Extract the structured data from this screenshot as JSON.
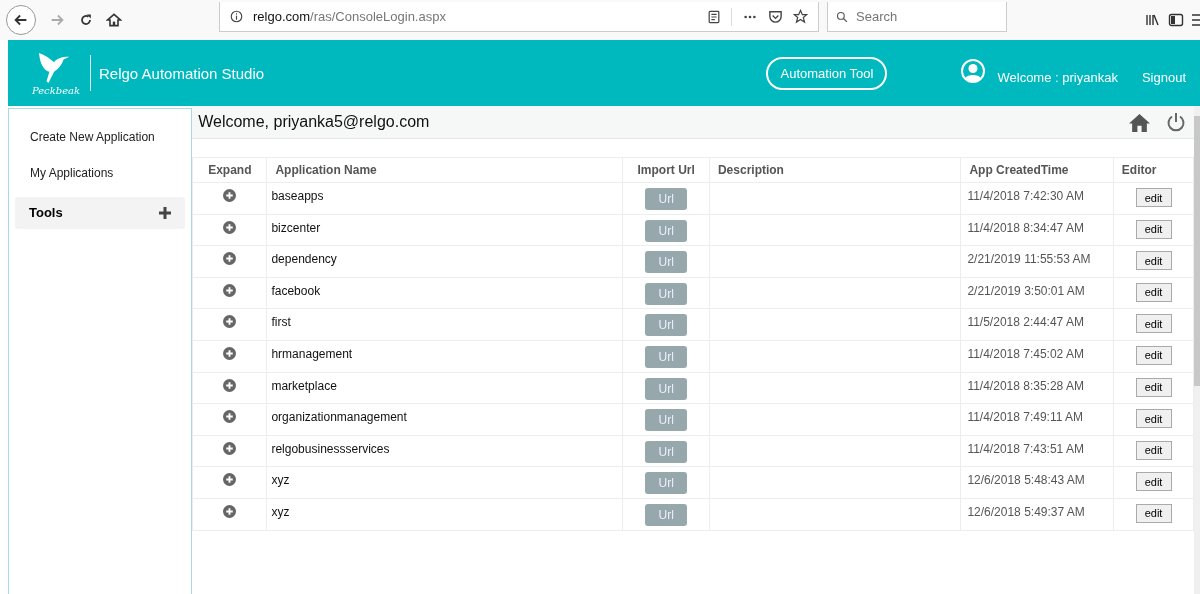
{
  "browser": {
    "url_host": "relgo.com",
    "url_path": "/ras/ConsoleLogin.aspx",
    "search_placeholder": "Search"
  },
  "header": {
    "logo_text": "Peckbeak",
    "title": "Relgo Automation Studio",
    "tool_button": "Automation Tool",
    "welcome": "Welcome : priyankak",
    "signout": "Signout"
  },
  "sidebar": {
    "items": [
      {
        "label": "Create New Application",
        "kind": "link"
      },
      {
        "label": "My Applications",
        "kind": "link"
      },
      {
        "label": "Tools",
        "kind": "section",
        "expanded": false
      }
    ]
  },
  "page_title": "Welcome, priyanka5@relgo.com",
  "table": {
    "columns": [
      "Expand",
      "Application Name",
      "Import Url",
      "Description",
      "App CreatedTime",
      "Editor"
    ],
    "rows": [
      {
        "name": "baseapps",
        "url_button": "Url",
        "description": "",
        "created": "11/4/2018 7:42:30 AM",
        "edit_button": "edit"
      },
      {
        "name": "bizcenter",
        "url_button": "Url",
        "created": "11/4/2018 8:34:47 AM",
        "edit_button": "edit"
      },
      {
        "name": "dependency",
        "url_button": "Url",
        "created": "2/21/2019 11:55:53 AM",
        "edit_button": "edit"
      },
      {
        "name": "facebook",
        "url_button": "Url",
        "created": "2/21/2019 3:50:01 AM",
        "edit_button": "edit"
      },
      {
        "name": "first",
        "url_button": "Url",
        "created": "11/5/2018 2:44:47 AM",
        "edit_button": "edit"
      },
      {
        "name": "hrmanagement",
        "url_button": "Url",
        "created": "11/4/2018 7:45:02 AM",
        "edit_button": "edit"
      },
      {
        "name": "marketplace",
        "url_button": "Url",
        "created": "11/4/2018 8:35:28 AM",
        "edit_button": "edit"
      },
      {
        "name": "organizationmanagement",
        "url_button": "Url",
        "created": "11/4/2018 7:49:11 AM",
        "edit_button": "edit"
      },
      {
        "name": "relgobusinessservices",
        "url_button": "Url",
        "created": "11/4/2018 7:43:51 AM",
        "edit_button": "edit"
      },
      {
        "name": "xyz",
        "url_button": "Url",
        "created": "12/6/2018 5:48:43 AM",
        "edit_button": "edit"
      },
      {
        "name": "xyz",
        "url_button": "Url",
        "created": "12/6/2018 5:49:37 AM",
        "edit_button": "edit"
      }
    ]
  }
}
